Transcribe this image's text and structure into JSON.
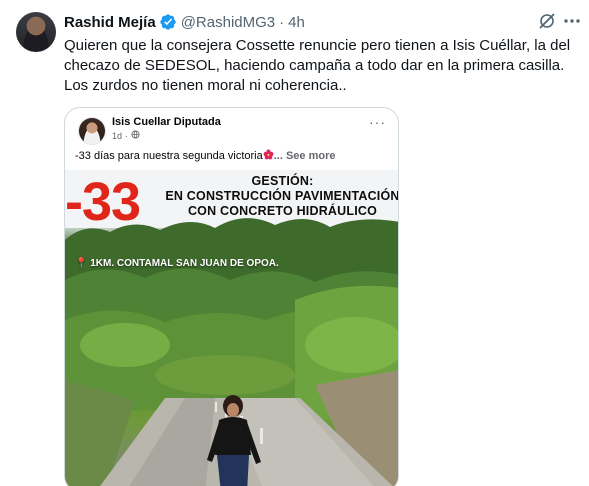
{
  "author": {
    "name": "Rashid Mejía",
    "handle": "@RashidMG3",
    "separator": "·",
    "time": "4h",
    "verified": true
  },
  "tweet": {
    "text": "Quieren que la consejera Cossette renuncie pero tienen a Isis Cuéllar, la del checazo de SEDESOL, haciendo campaña a todo dar en la primera casilla. Los zurdos no tienen moral ni coherencia.."
  },
  "icons": {
    "verified": "verified-badge-icon",
    "grok": "grok-icon",
    "more": "more-options-icon"
  },
  "embedded_post": {
    "page_name": "Isis Cuellar Diputada",
    "age": "1d",
    "separator": "·",
    "caption": "-33 días para nuestra segunda victoria",
    "see_more": "... See more",
    "more": "···",
    "image": {
      "countdown": "-33",
      "headline_1": "GESTIÓN:",
      "headline_2": "EN CONSTRUCCIÓN PAVIMENTACIÓN",
      "headline_3": "CON CONCRETO HIDRÁULICO",
      "location": "1KM. CONTAMAL SAN JUAN DE OPOA."
    }
  },
  "colors": {
    "accent_verified": "#1d9bf0",
    "muted_text": "#536471",
    "countdown_red": "#e0261b"
  }
}
